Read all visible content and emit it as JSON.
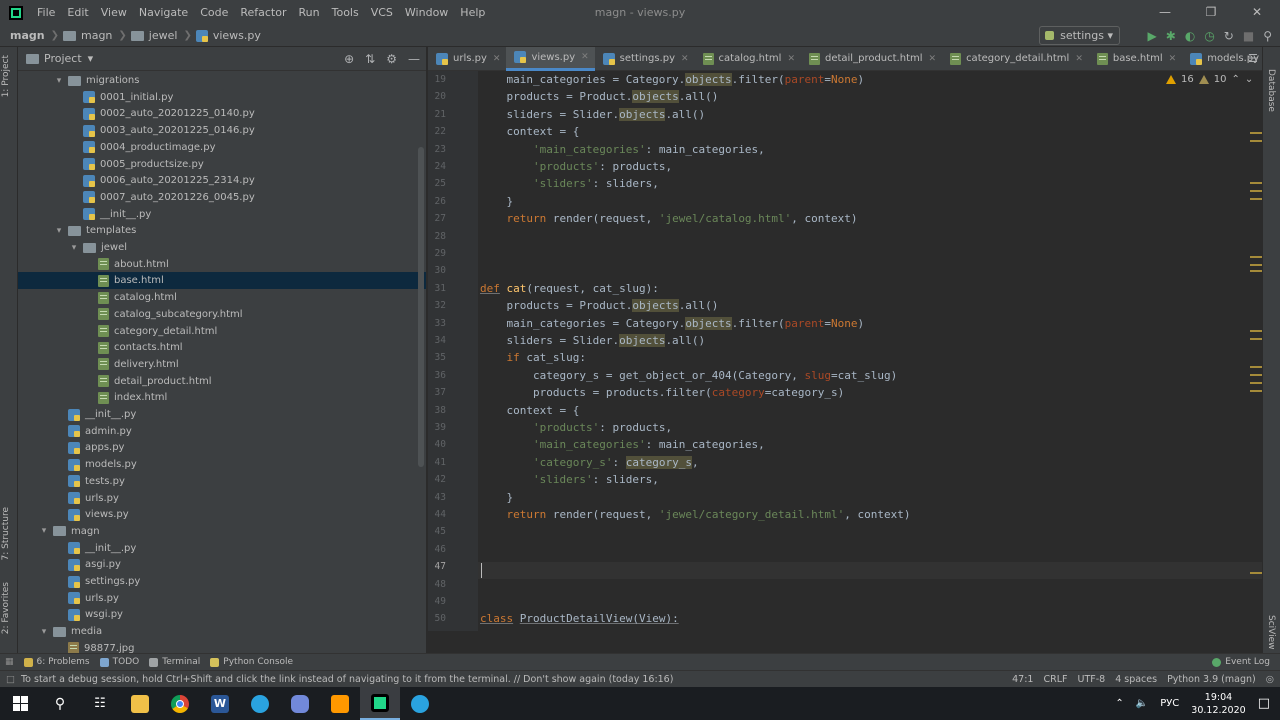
{
  "window": {
    "title": "magn - views.py",
    "menu": [
      "File",
      "Edit",
      "View",
      "Navigate",
      "Code",
      "Refactor",
      "Run",
      "Tools",
      "VCS",
      "Window",
      "Help"
    ]
  },
  "breadcrumb": [
    "magn",
    "magn",
    "jewel",
    "views.py"
  ],
  "run_config": "settings",
  "project_panel": {
    "title": "Project",
    "side_tabs": {
      "project": "1: Project",
      "structure": "7: Structure",
      "favorites": "2: Favorites"
    },
    "tree": [
      {
        "label": "migrations",
        "type": "folder",
        "depth": 2,
        "expanded": true
      },
      {
        "label": "0001_initial.py",
        "type": "py",
        "depth": 3
      },
      {
        "label": "0002_auto_20201225_0140.py",
        "type": "py",
        "depth": 3
      },
      {
        "label": "0003_auto_20201225_0146.py",
        "type": "py",
        "depth": 3
      },
      {
        "label": "0004_productimage.py",
        "type": "py",
        "depth": 3
      },
      {
        "label": "0005_productsize.py",
        "type": "py",
        "depth": 3
      },
      {
        "label": "0006_auto_20201225_2314.py",
        "type": "py",
        "depth": 3
      },
      {
        "label": "0007_auto_20201226_0045.py",
        "type": "py",
        "depth": 3
      },
      {
        "label": "__init__.py",
        "type": "py",
        "depth": 3
      },
      {
        "label": "templates",
        "type": "folder",
        "depth": 2,
        "expanded": true
      },
      {
        "label": "jewel",
        "type": "folder",
        "depth": 3,
        "expanded": true
      },
      {
        "label": "about.html",
        "type": "html",
        "depth": 4
      },
      {
        "label": "base.html",
        "type": "html",
        "depth": 4,
        "selected": true
      },
      {
        "label": "catalog.html",
        "type": "html",
        "depth": 4
      },
      {
        "label": "catalog_subcategory.html",
        "type": "html",
        "depth": 4
      },
      {
        "label": "category_detail.html",
        "type": "html",
        "depth": 4
      },
      {
        "label": "contacts.html",
        "type": "html",
        "depth": 4
      },
      {
        "label": "delivery.html",
        "type": "html",
        "depth": 4
      },
      {
        "label": "detail_product.html",
        "type": "html",
        "depth": 4
      },
      {
        "label": "index.html",
        "type": "html",
        "depth": 4
      },
      {
        "label": "__init__.py",
        "type": "py",
        "depth": 2
      },
      {
        "label": "admin.py",
        "type": "py",
        "depth": 2
      },
      {
        "label": "apps.py",
        "type": "py",
        "depth": 2
      },
      {
        "label": "models.py",
        "type": "py",
        "depth": 2
      },
      {
        "label": "tests.py",
        "type": "py",
        "depth": 2
      },
      {
        "label": "urls.py",
        "type": "py",
        "depth": 2
      },
      {
        "label": "views.py",
        "type": "py",
        "depth": 2
      },
      {
        "label": "magn",
        "type": "folder",
        "depth": 1,
        "expanded": true
      },
      {
        "label": "__init__.py",
        "type": "py",
        "depth": 2
      },
      {
        "label": "asgi.py",
        "type": "py",
        "depth": 2
      },
      {
        "label": "settings.py",
        "type": "py",
        "depth": 2
      },
      {
        "label": "urls.py",
        "type": "py",
        "depth": 2
      },
      {
        "label": "wsgi.py",
        "type": "py",
        "depth": 2
      },
      {
        "label": "media",
        "type": "folder",
        "depth": 1,
        "expanded": true
      },
      {
        "label": "98877.jpg",
        "type": "img",
        "depth": 2
      }
    ]
  },
  "tabs": [
    {
      "label": "urls.py",
      "type": "py"
    },
    {
      "label": "views.py",
      "type": "py",
      "active": true
    },
    {
      "label": "settings.py",
      "type": "py"
    },
    {
      "label": "catalog.html",
      "type": "html"
    },
    {
      "label": "detail_product.html",
      "type": "html"
    },
    {
      "label": "category_detail.html",
      "type": "html"
    },
    {
      "label": "base.html",
      "type": "html"
    },
    {
      "label": "models.py",
      "type": "py"
    },
    {
      "label": "adm",
      "type": "py"
    }
  ],
  "editor": {
    "warnings": "16",
    "weak_warnings": "10",
    "current_line": "47",
    "lines": [
      {
        "n": "19",
        "html": "    main_categories = Category.<span class='hl'>objects</span>.filter(<span class='prm'>parent</span>=<span class='kw'>None</span>)"
      },
      {
        "n": "20",
        "html": "    products = Product.<span class='hl'>objects</span>.all()"
      },
      {
        "n": "21",
        "html": "    sliders = Slider.<span class='hl'>objects</span>.all()"
      },
      {
        "n": "22",
        "html": "    context = {"
      },
      {
        "n": "23",
        "html": "        <span class='str'>'main_categories'</span>: main_categories,"
      },
      {
        "n": "24",
        "html": "        <span class='str'>'products'</span>: products,"
      },
      {
        "n": "25",
        "html": "        <span class='str'>'sliders'</span>: sliders,"
      },
      {
        "n": "26",
        "html": "    }"
      },
      {
        "n": "27",
        "html": "    <span class='kw'>return</span> render(request, <span class='str'>'jewel/catalog.html'</span>, context)"
      },
      {
        "n": "28",
        "html": ""
      },
      {
        "n": "29",
        "html": ""
      },
      {
        "n": "30",
        "html": ""
      },
      {
        "n": "31",
        "html": "<span class='defkw'>def</span> <span class='fn'>cat</span>(request, cat_slug):"
      },
      {
        "n": "32",
        "html": "    products = Product.<span class='hl'>objects</span>.all()"
      },
      {
        "n": "33",
        "html": "    main_categories = Category.<span class='hl'>objects</span>.filter(<span class='prm'>parent</span>=<span class='kw'>None</span>)"
      },
      {
        "n": "34",
        "html": "    sliders = Slider.<span class='hl'>objects</span>.all()"
      },
      {
        "n": "35",
        "html": "    <span class='kw'>if</span> cat_slug:"
      },
      {
        "n": "36",
        "html": "        category_s = get_object_or_404(Category, <span class='prm'>slug</span>=cat_slug)"
      },
      {
        "n": "37",
        "html": "        products = products.filter(<span class='prm'>category</span>=category_s)"
      },
      {
        "n": "38",
        "html": "    context = {"
      },
      {
        "n": "39",
        "html": "        <span class='str'>'products'</span>: products,"
      },
      {
        "n": "40",
        "html": "        <span class='str'>'main_categories'</span>: main_categories,"
      },
      {
        "n": "41",
        "html": "        <span class='str'>'category_s'</span>: <span class='hl'>category_s</span>,"
      },
      {
        "n": "42",
        "html": "        <span class='str'>'sliders'</span>: sliders,"
      },
      {
        "n": "43",
        "html": "    }"
      },
      {
        "n": "44",
        "html": "    <span class='kw'>return</span> render(request, <span class='str'>'jewel/category_detail.html'</span>, context)"
      },
      {
        "n": "45",
        "html": ""
      },
      {
        "n": "46",
        "html": ""
      },
      {
        "n": "47",
        "html": ""
      },
      {
        "n": "48",
        "html": ""
      },
      {
        "n": "49",
        "html": ""
      },
      {
        "n": "50",
        "html": "<span class='defkw'>class</span> <span class='defkw' style='color:#a9b7c6'>ProductDetailView(View):</span>"
      }
    ]
  },
  "right_strip": {
    "database": "Database",
    "sciview": "SciView"
  },
  "bottom_tools": [
    {
      "label": "6: Problems",
      "icon": "problems-icon"
    },
    {
      "label": "TODO",
      "icon": "todo-icon"
    },
    {
      "label": "Terminal",
      "icon": "terminal-icon"
    },
    {
      "label": "Python Console",
      "icon": "python-console-icon"
    }
  ],
  "event_log": "Event Log",
  "status": {
    "message": "To start a debug session, hold Ctrl+Shift and click the link instead of navigating to it from the terminal. // Don't show again (today 16:16)",
    "position": "47:1",
    "line_sep": "CRLF",
    "encoding": "UTF-8",
    "indent": "4 spaces",
    "interpreter": "Python 3.9 (magn)"
  },
  "taskbar": {
    "lang": "РУС",
    "time": "19:04",
    "date": "30.12.2020",
    "apps": [
      "start-icon",
      "search-icon",
      "task-view-icon",
      "file-explorer-icon",
      "chrome-icon",
      "word-icon",
      "telegram-icon",
      "discord-icon",
      "sublime-icon",
      "pycharm-icon",
      "telegram-alt-icon"
    ]
  }
}
